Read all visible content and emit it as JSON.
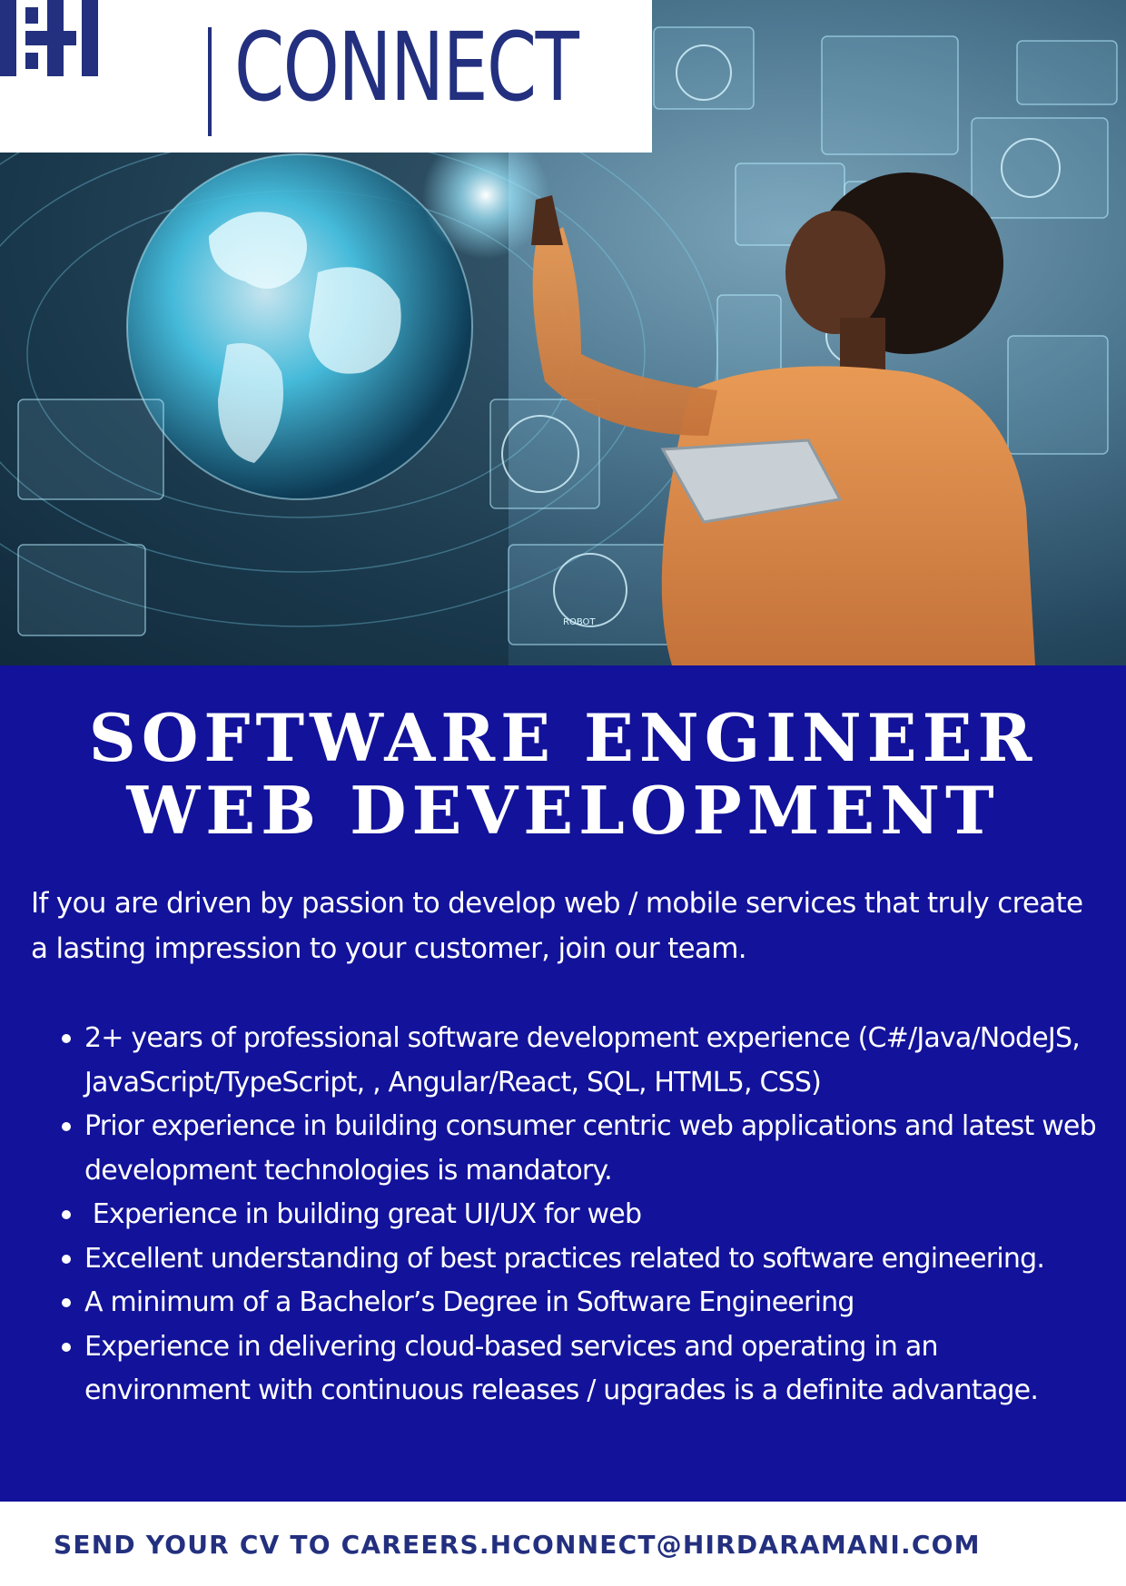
{
  "logo": {
    "mark": "HI",
    "brand": "CONNECT"
  },
  "title": {
    "line1": "SOFTWARE ENGINEER",
    "line2": "WEB DEVELOPMENT"
  },
  "intro": "If you are driven by passion to develop web / mobile services that truly create a lasting impression to your customer, join our team.",
  "requirements": [
    "2+ years of professional software development experience (C#/Java/NodeJS, JavaScript/TypeScript, , Angular/React, SQL, HTML5, CSS)",
    "Prior experience in building consumer centric web applications and latest web development technologies is mandatory.",
    " Experience in building great UI/UX for web",
    "Excellent understanding of best practices related to software engineering.",
    "A minimum of a Bachelor’s Degree in Software Engineering",
    "Experience in delivering cloud-based services and operating in an environment with continuous releases / upgrades is a definite advantage."
  ],
  "footer": {
    "cta": "SEND YOUR CV TO CAREERS.HCONNECT@HIRDARAMANI.COM"
  },
  "hero": {
    "label": "ROBOT"
  },
  "colors": {
    "panel": "#12129a",
    "brand": "#23307f",
    "text_on_panel": "#ffffff"
  }
}
